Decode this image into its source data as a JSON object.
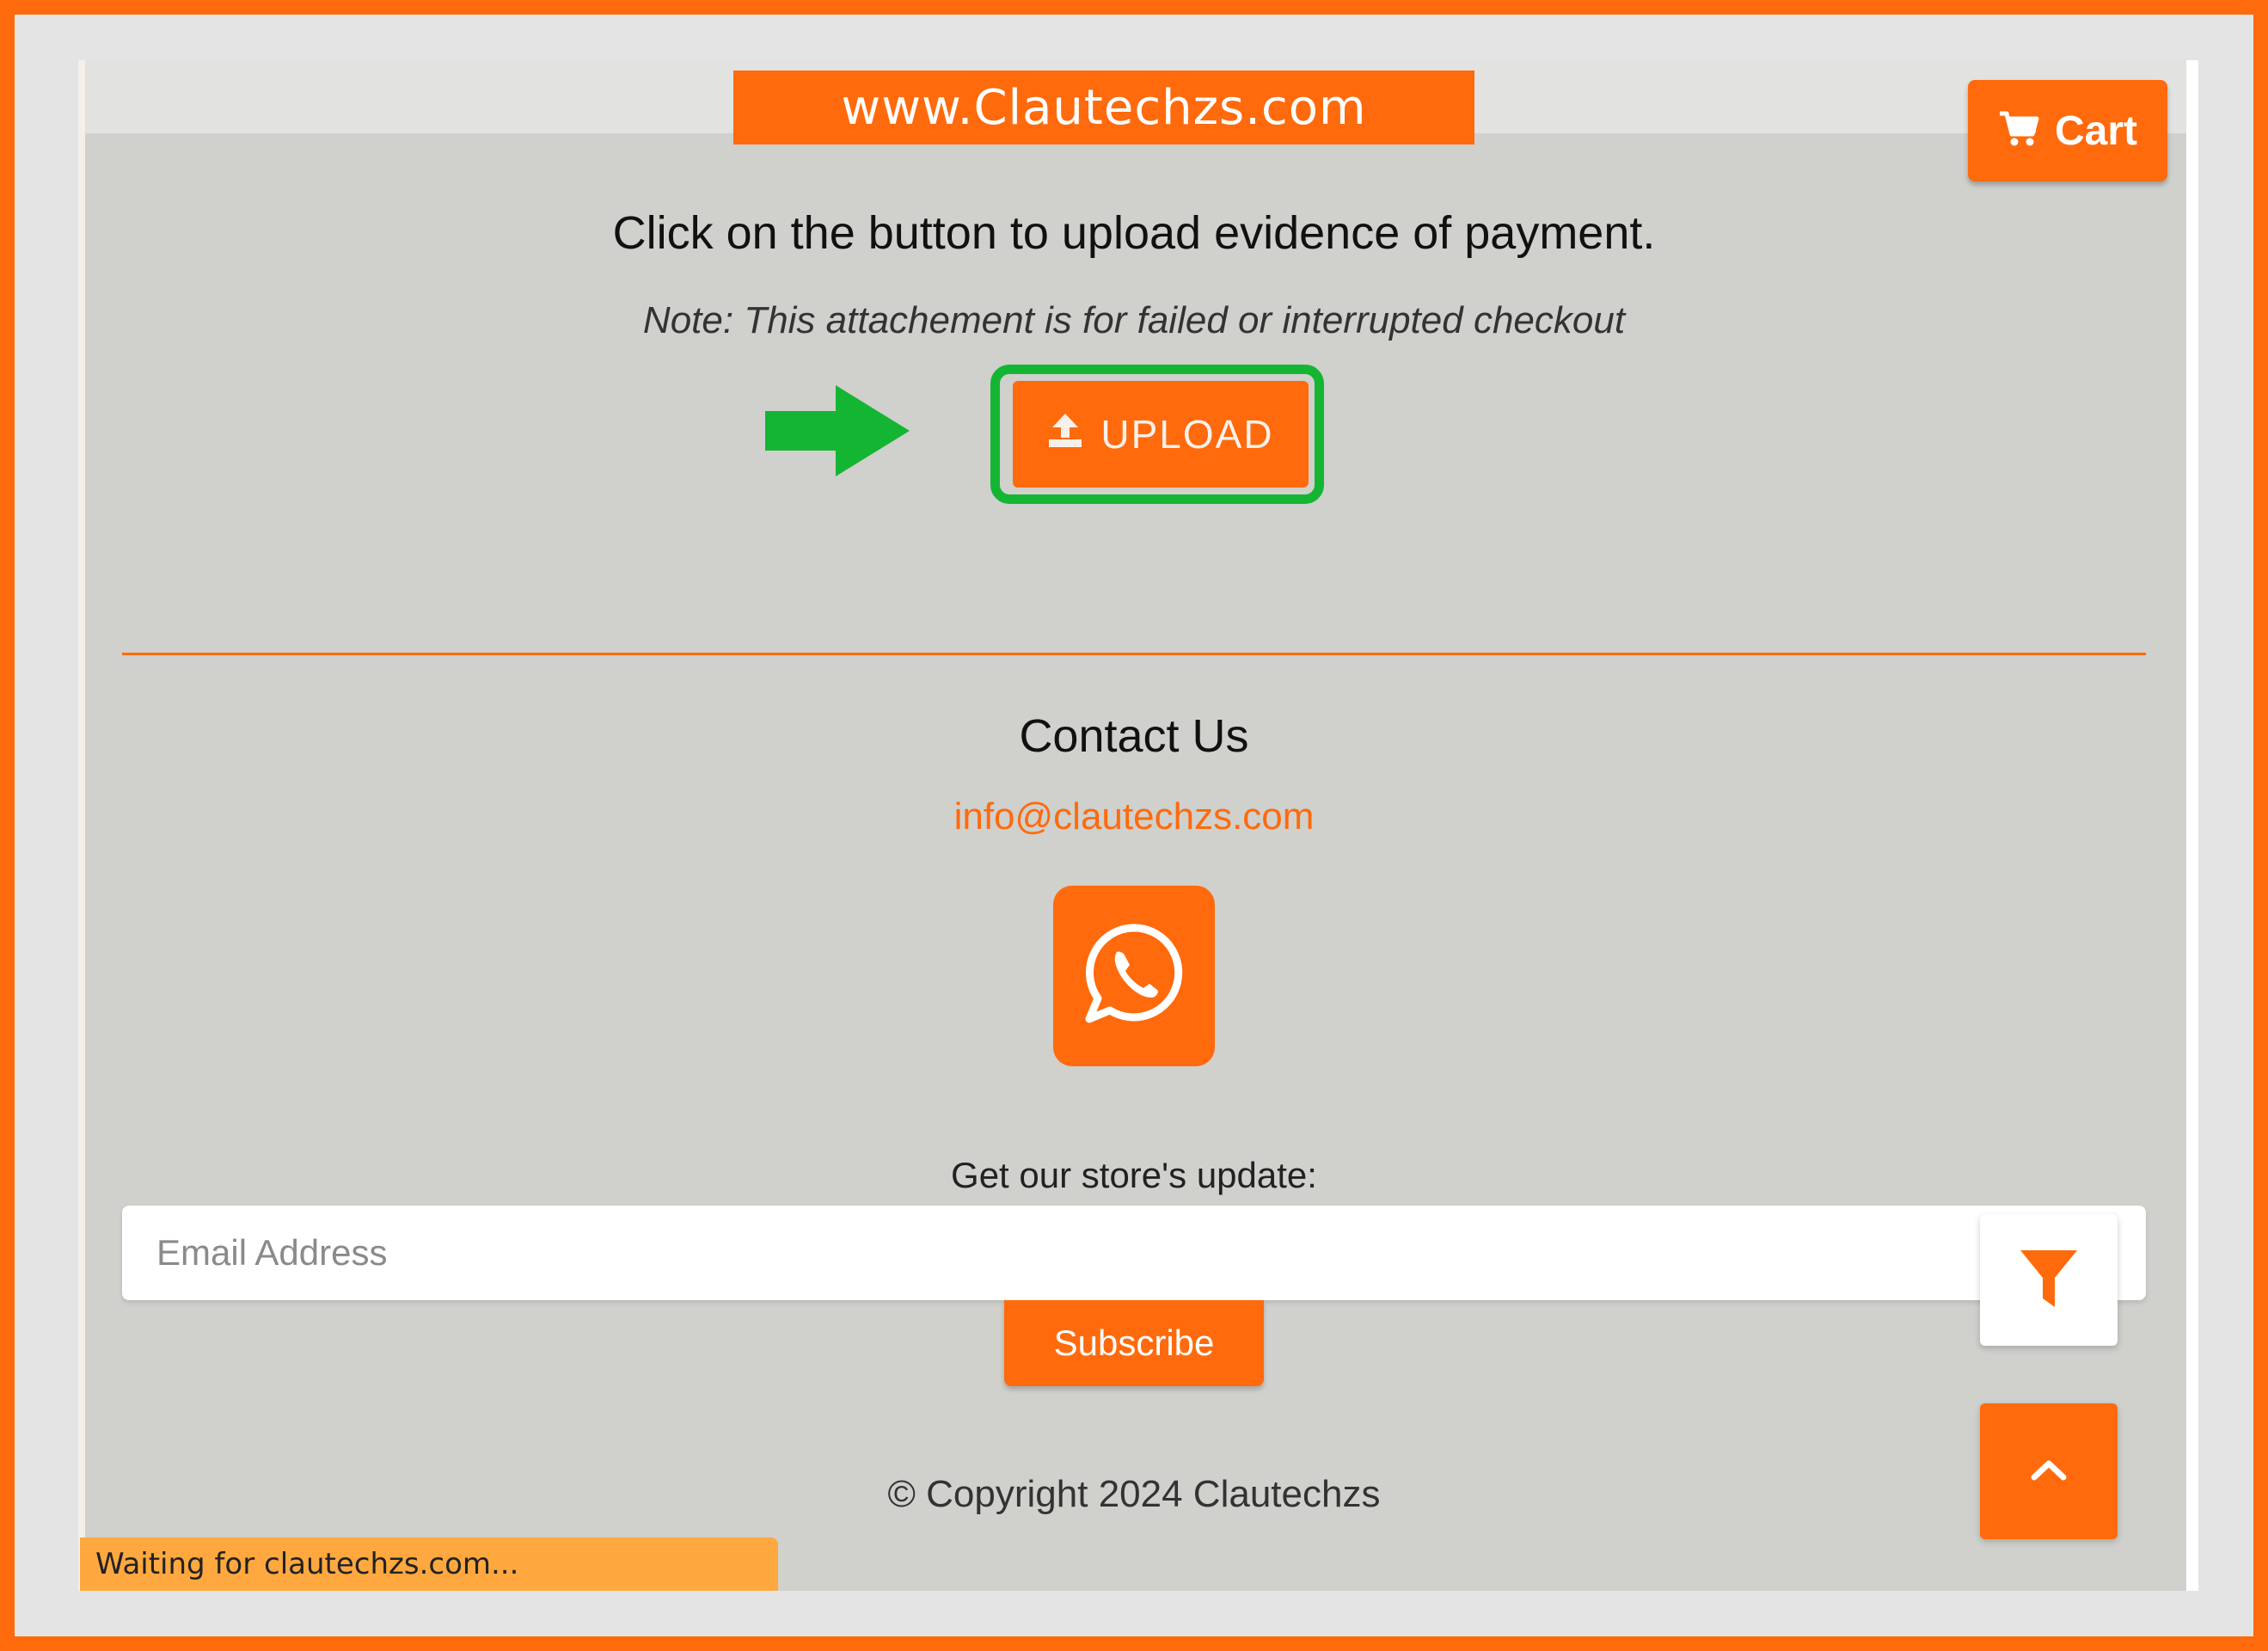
{
  "banner": {
    "url_text": "www.Clautechzs.com"
  },
  "header": {
    "cart_label": "Cart"
  },
  "payment": {
    "instruction": "Click on the button to upload evidence of payment.",
    "note": "Note: This attachement is for failed or interrupted checkout",
    "upload_label": "UPLOAD"
  },
  "contact": {
    "title": "Contact Us",
    "email": "info@clautechzs.com"
  },
  "newsletter": {
    "label": "Get our store's update:",
    "email_placeholder": "Email Address",
    "email_value": "",
    "subscribe_label": "Subscribe"
  },
  "footer": {
    "copyright": "© Copyright 2024 Clautechzs"
  },
  "browser": {
    "status_text": "Waiting for clautechzs.com..."
  },
  "icons": {
    "cart": "cart-icon",
    "upload": "upload-icon",
    "whatsapp": "whatsapp-icon",
    "filter": "filter-icon",
    "scroll_top": "chevron-up-icon",
    "pointer": "green-arrow-icon"
  },
  "colors": {
    "brand_orange": "#ff6a0c",
    "highlight_green": "#14b533",
    "page_gray": "#d0d0cd",
    "status_orange": "#ffa840"
  }
}
